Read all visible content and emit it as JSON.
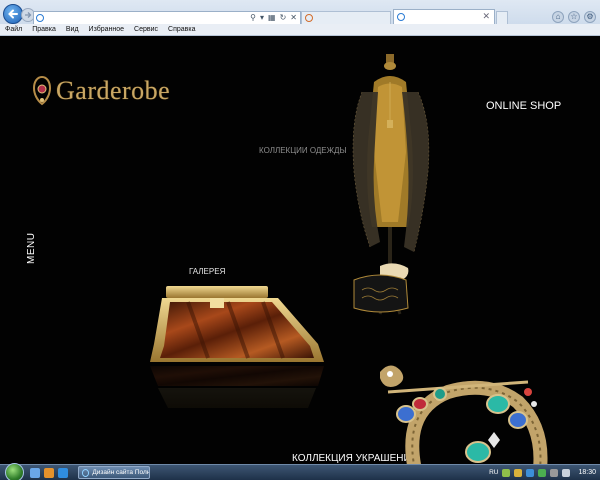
{
  "browser": {
    "menu": [
      "Файл",
      "Правка",
      "Вид",
      "Избранное",
      "Сервис",
      "Справка"
    ],
    "address_value": ""
  },
  "site": {
    "logo_text": "Garderobe",
    "menu_label": "MENU",
    "links": {
      "clothes": "КОЛЛЕКЦИИ ОДЕЖДЫ",
      "gallery": "ГАЛЕРЕЯ",
      "online_shop": "ONLINE SHOP",
      "jewelry": "КОЛЛЕКЦИЯ УКРАШЕНИЙ"
    },
    "colors": {
      "background": "#020202",
      "logo_gold": "#c9a764"
    }
  },
  "taskbar": {
    "task_label": "Дизайн сайта Полн...",
    "lang": "RU",
    "clock": "18:30"
  }
}
